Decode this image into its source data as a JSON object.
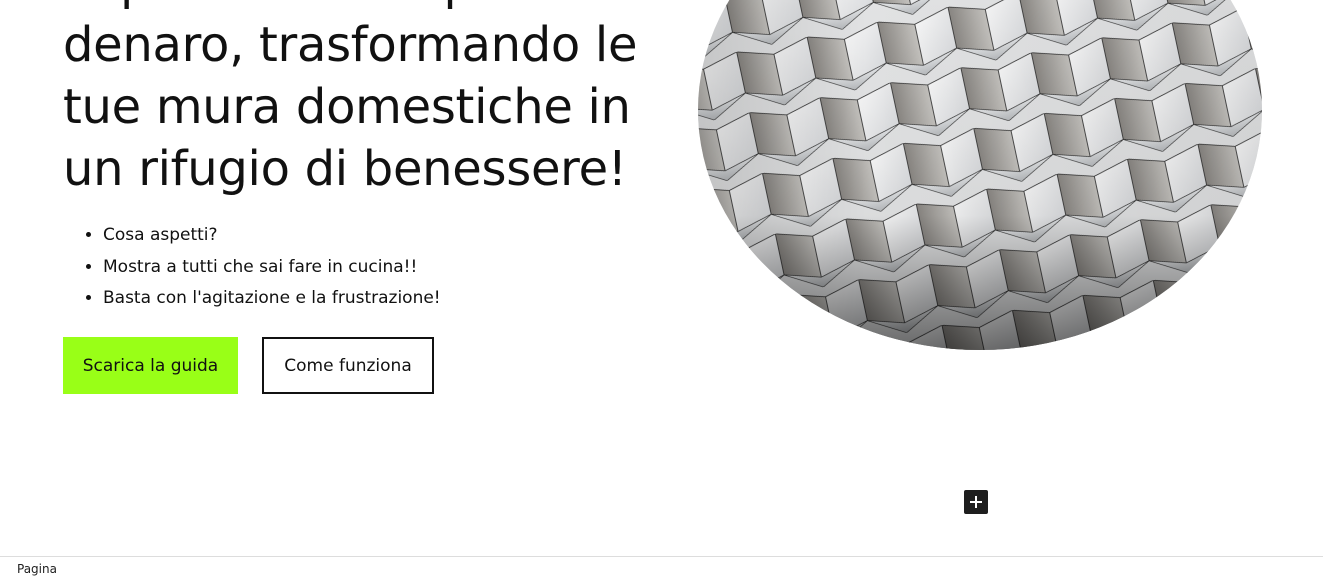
{
  "hero": {
    "heading_lines": [
      "risparmiare tempo e",
      "denaro, trasformando le",
      "tue mura domestiche in",
      "un rifugio di benessere!"
    ],
    "bullets": [
      "Cosa aspetti?",
      "Mostra a tutti che sai fare in cucina!!",
      "Basta con l'agitazione e la frustrazione!"
    ],
    "primary_button": "Scarica la guida",
    "secondary_button": "Come funziona",
    "image": "architecture-facade-photo"
  },
  "editor": {
    "add_block_icon": "plus-icon",
    "breadcrumb": "Pagina"
  },
  "colors": {
    "accent": "#99ff17",
    "text": "#111111",
    "inserter_bg": "#1e1e1e"
  }
}
